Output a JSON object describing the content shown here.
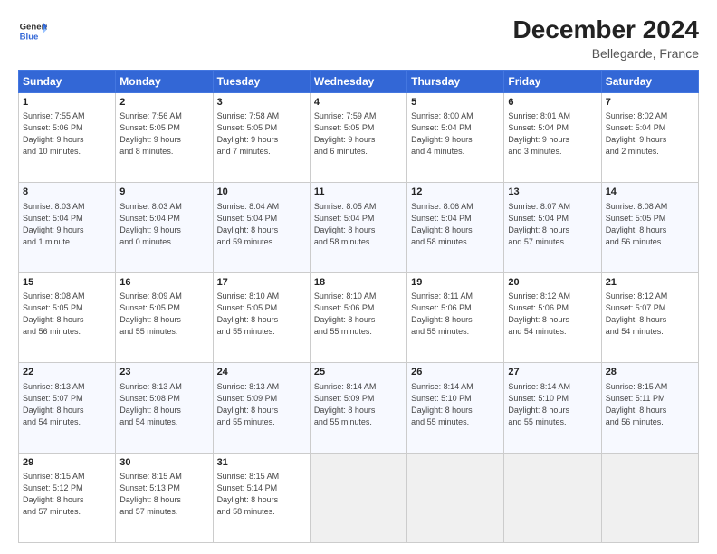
{
  "header": {
    "logo_line1": "General",
    "logo_line2": "Blue",
    "month": "December 2024",
    "location": "Bellegarde, France"
  },
  "weekdays": [
    "Sunday",
    "Monday",
    "Tuesday",
    "Wednesday",
    "Thursday",
    "Friday",
    "Saturday"
  ],
  "weeks": [
    [
      {
        "day": "1",
        "lines": [
          "Sunrise: 7:55 AM",
          "Sunset: 5:06 PM",
          "Daylight: 9 hours",
          "and 10 minutes."
        ]
      },
      {
        "day": "2",
        "lines": [
          "Sunrise: 7:56 AM",
          "Sunset: 5:05 PM",
          "Daylight: 9 hours",
          "and 8 minutes."
        ]
      },
      {
        "day": "3",
        "lines": [
          "Sunrise: 7:58 AM",
          "Sunset: 5:05 PM",
          "Daylight: 9 hours",
          "and 7 minutes."
        ]
      },
      {
        "day": "4",
        "lines": [
          "Sunrise: 7:59 AM",
          "Sunset: 5:05 PM",
          "Daylight: 9 hours",
          "and 6 minutes."
        ]
      },
      {
        "day": "5",
        "lines": [
          "Sunrise: 8:00 AM",
          "Sunset: 5:04 PM",
          "Daylight: 9 hours",
          "and 4 minutes."
        ]
      },
      {
        "day": "6",
        "lines": [
          "Sunrise: 8:01 AM",
          "Sunset: 5:04 PM",
          "Daylight: 9 hours",
          "and 3 minutes."
        ]
      },
      {
        "day": "7",
        "lines": [
          "Sunrise: 8:02 AM",
          "Sunset: 5:04 PM",
          "Daylight: 9 hours",
          "and 2 minutes."
        ]
      }
    ],
    [
      {
        "day": "8",
        "lines": [
          "Sunrise: 8:03 AM",
          "Sunset: 5:04 PM",
          "Daylight: 9 hours",
          "and 1 minute."
        ]
      },
      {
        "day": "9",
        "lines": [
          "Sunrise: 8:03 AM",
          "Sunset: 5:04 PM",
          "Daylight: 9 hours",
          "and 0 minutes."
        ]
      },
      {
        "day": "10",
        "lines": [
          "Sunrise: 8:04 AM",
          "Sunset: 5:04 PM",
          "Daylight: 8 hours",
          "and 59 minutes."
        ]
      },
      {
        "day": "11",
        "lines": [
          "Sunrise: 8:05 AM",
          "Sunset: 5:04 PM",
          "Daylight: 8 hours",
          "and 58 minutes."
        ]
      },
      {
        "day": "12",
        "lines": [
          "Sunrise: 8:06 AM",
          "Sunset: 5:04 PM",
          "Daylight: 8 hours",
          "and 58 minutes."
        ]
      },
      {
        "day": "13",
        "lines": [
          "Sunrise: 8:07 AM",
          "Sunset: 5:04 PM",
          "Daylight: 8 hours",
          "and 57 minutes."
        ]
      },
      {
        "day": "14",
        "lines": [
          "Sunrise: 8:08 AM",
          "Sunset: 5:05 PM",
          "Daylight: 8 hours",
          "and 56 minutes."
        ]
      }
    ],
    [
      {
        "day": "15",
        "lines": [
          "Sunrise: 8:08 AM",
          "Sunset: 5:05 PM",
          "Daylight: 8 hours",
          "and 56 minutes."
        ]
      },
      {
        "day": "16",
        "lines": [
          "Sunrise: 8:09 AM",
          "Sunset: 5:05 PM",
          "Daylight: 8 hours",
          "and 55 minutes."
        ]
      },
      {
        "day": "17",
        "lines": [
          "Sunrise: 8:10 AM",
          "Sunset: 5:05 PM",
          "Daylight: 8 hours",
          "and 55 minutes."
        ]
      },
      {
        "day": "18",
        "lines": [
          "Sunrise: 8:10 AM",
          "Sunset: 5:06 PM",
          "Daylight: 8 hours",
          "and 55 minutes."
        ]
      },
      {
        "day": "19",
        "lines": [
          "Sunrise: 8:11 AM",
          "Sunset: 5:06 PM",
          "Daylight: 8 hours",
          "and 55 minutes."
        ]
      },
      {
        "day": "20",
        "lines": [
          "Sunrise: 8:12 AM",
          "Sunset: 5:06 PM",
          "Daylight: 8 hours",
          "and 54 minutes."
        ]
      },
      {
        "day": "21",
        "lines": [
          "Sunrise: 8:12 AM",
          "Sunset: 5:07 PM",
          "Daylight: 8 hours",
          "and 54 minutes."
        ]
      }
    ],
    [
      {
        "day": "22",
        "lines": [
          "Sunrise: 8:13 AM",
          "Sunset: 5:07 PM",
          "Daylight: 8 hours",
          "and 54 minutes."
        ]
      },
      {
        "day": "23",
        "lines": [
          "Sunrise: 8:13 AM",
          "Sunset: 5:08 PM",
          "Daylight: 8 hours",
          "and 54 minutes."
        ]
      },
      {
        "day": "24",
        "lines": [
          "Sunrise: 8:13 AM",
          "Sunset: 5:09 PM",
          "Daylight: 8 hours",
          "and 55 minutes."
        ]
      },
      {
        "day": "25",
        "lines": [
          "Sunrise: 8:14 AM",
          "Sunset: 5:09 PM",
          "Daylight: 8 hours",
          "and 55 minutes."
        ]
      },
      {
        "day": "26",
        "lines": [
          "Sunrise: 8:14 AM",
          "Sunset: 5:10 PM",
          "Daylight: 8 hours",
          "and 55 minutes."
        ]
      },
      {
        "day": "27",
        "lines": [
          "Sunrise: 8:14 AM",
          "Sunset: 5:10 PM",
          "Daylight: 8 hours",
          "and 55 minutes."
        ]
      },
      {
        "day": "28",
        "lines": [
          "Sunrise: 8:15 AM",
          "Sunset: 5:11 PM",
          "Daylight: 8 hours",
          "and 56 minutes."
        ]
      }
    ],
    [
      {
        "day": "29",
        "lines": [
          "Sunrise: 8:15 AM",
          "Sunset: 5:12 PM",
          "Daylight: 8 hours",
          "and 57 minutes."
        ]
      },
      {
        "day": "30",
        "lines": [
          "Sunrise: 8:15 AM",
          "Sunset: 5:13 PM",
          "Daylight: 8 hours",
          "and 57 minutes."
        ]
      },
      {
        "day": "31",
        "lines": [
          "Sunrise: 8:15 AM",
          "Sunset: 5:14 PM",
          "Daylight: 8 hours",
          "and 58 minutes."
        ]
      },
      null,
      null,
      null,
      null
    ]
  ]
}
